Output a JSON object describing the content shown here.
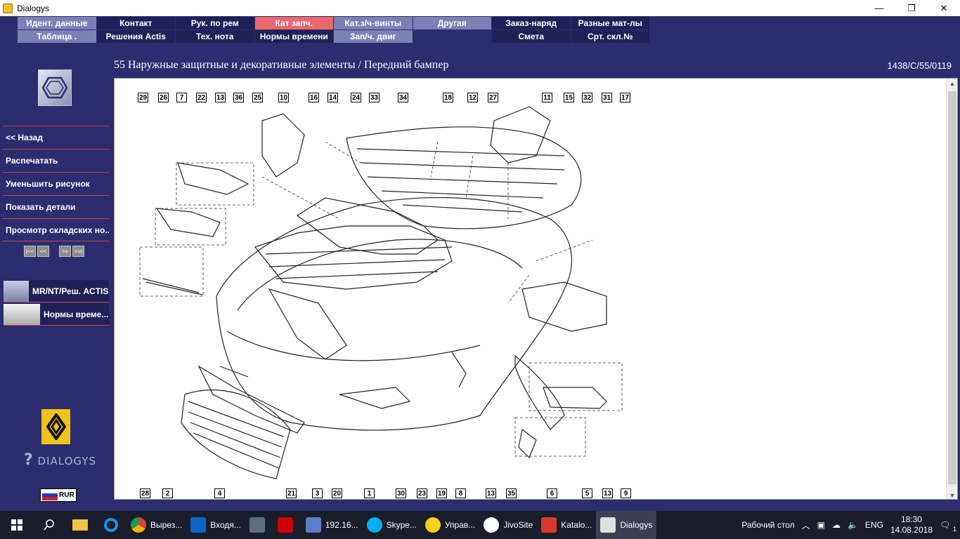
{
  "window": {
    "title": "Dialogys",
    "minimize": "—",
    "maximize": "❐",
    "close": "✕"
  },
  "menu": {
    "row1": [
      "Идент. данные",
      "Контакт",
      "Рук. по рем",
      "Кат запч.",
      "Кат.з/ч-винты",
      "Другая",
      "Заказ-наряд",
      "Разные мат-лы"
    ],
    "row2": [
      "Таблица .",
      "Решения Actis",
      "Тех. нота",
      "Нормы времени",
      "Зап/ч. двиг",
      "",
      "Смета",
      "Срт. скл.№"
    ]
  },
  "sidebar": {
    "items": [
      "<< Назад",
      "Распечатать",
      "Уменьшить рисунок",
      "Показать детали",
      "Просмотр складских но..."
    ],
    "pager": [
      "|<<",
      "<<",
      ">>",
      ">>|"
    ],
    "tool1": "MR/NT/Реш. ACTIS",
    "tool2": "Нормы време...",
    "brand": "DIALOGYS",
    "currency": "RUR"
  },
  "header": {
    "title": "55 Наружные защитные и декоративные элементы / Передний бампер",
    "code": "1438/C/55/0119"
  },
  "diagram": {
    "top_labels": [
      "29",
      "26",
      "7",
      "22",
      "13",
      "36",
      "25",
      "10",
      "16",
      "14",
      "24",
      "33",
      "34",
      "18",
      "12",
      "27",
      "11",
      "15",
      "32",
      "31",
      "17"
    ],
    "bottom_labels": [
      "28",
      "2",
      "4",
      "21",
      "3",
      "20",
      "1",
      "30",
      "23",
      "19",
      "8",
      "13",
      "35",
      "6",
      "5",
      "13",
      "9"
    ]
  },
  "taskbar": {
    "apps": [
      "Вырез...",
      "Входя...",
      "",
      "",
      "192.16...",
      "Skype...",
      "Управ...",
      "JivoSite",
      "Katalo...",
      "Dialogys"
    ],
    "desktop": "Рабочий стол",
    "lang": "ENG",
    "time": "18:30",
    "date": "14.08.2018",
    "notif": "1"
  },
  "colors": {
    "app_bg": "#2b2d6e",
    "menu_active": "#e9676d",
    "menu_light": "#7c80b4",
    "menu_dark": "#1f2156",
    "separator": "#c84050"
  }
}
